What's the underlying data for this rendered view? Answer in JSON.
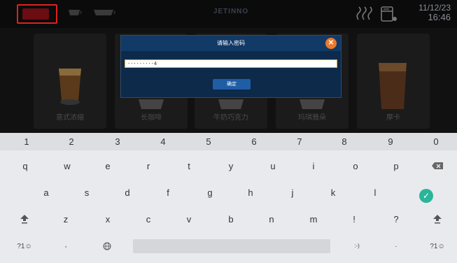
{
  "status_bar": {
    "brand": "JETINNO",
    "date": "11/12/23",
    "time": "16:46"
  },
  "products": [
    {
      "name": "意式浓缩"
    },
    {
      "name": "长咖啡"
    },
    {
      "name": "牛奶巧克力"
    },
    {
      "name": "玛琪雅朵"
    },
    {
      "name": "摩卡"
    }
  ],
  "dialog": {
    "title": "请输入密码",
    "password_value": "·········4",
    "confirm_label": "确定",
    "close_glyph": "✕"
  },
  "keyboard": {
    "numbers": [
      "1",
      "2",
      "3",
      "4",
      "5",
      "6",
      "7",
      "8",
      "9",
      "0"
    ],
    "row1": [
      "q",
      "w",
      "e",
      "r",
      "t",
      "y",
      "u",
      "i",
      "o",
      "p"
    ],
    "row2": [
      "a",
      "s",
      "d",
      "f",
      "g",
      "h",
      "j",
      "k",
      "l"
    ],
    "row3": [
      "z",
      "x",
      "c",
      "v",
      "b",
      "n",
      "m",
      "!",
      "?"
    ],
    "row1_sub": [
      ",",
      "?",
      ".",
      "'",
      "\"",
      ":",
      "-",
      "+",
      "=",
      "@"
    ],
    "sym_label": "?1☺",
    "comma": ",",
    "smiley": ":-)",
    "period": ".",
    "sym_label_right": "?1☺"
  },
  "colors": {
    "dialog_bg": "#0d2a4a",
    "confirm_button": "#1f5da5",
    "close_button": "#ea7a2c",
    "check_key": "#2ab59a",
    "highlight_border": "#e02020"
  },
  "icons": {
    "delete": "backspace-icon",
    "enter": "check-icon",
    "shift": "shift-icon",
    "globe": "globe-icon"
  }
}
